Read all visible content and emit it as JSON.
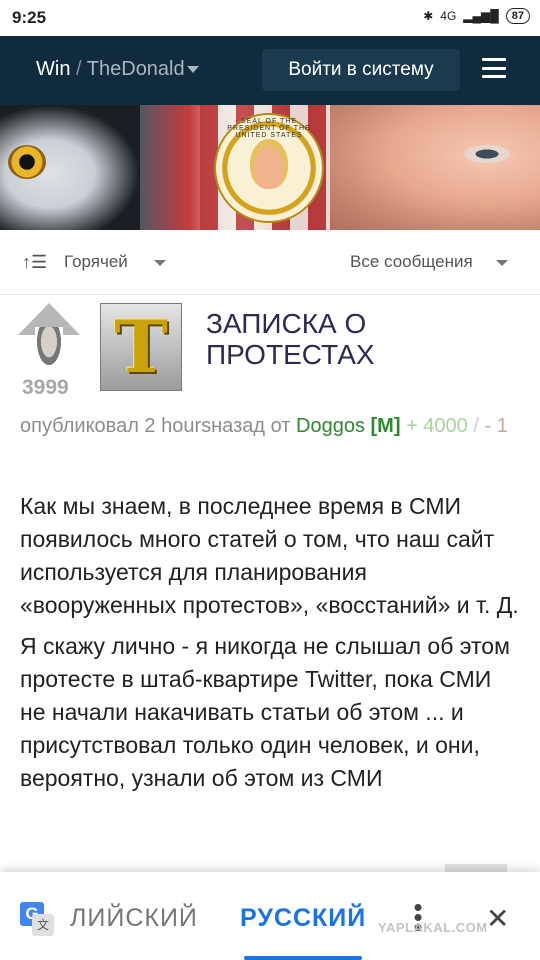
{
  "status_bar": {
    "time": "9:25",
    "network": "4G",
    "battery": "87"
  },
  "navbar": {
    "brand": "Win",
    "separator": "/",
    "community": "TheDonald",
    "login_label": "Войти в систему"
  },
  "banner": {
    "seal_text": "SEAL OF THE PRESIDENT OF THE UNITED STATES"
  },
  "sort": {
    "hot_label": "Горячей",
    "filter_label": "Все сообщения"
  },
  "post": {
    "score": "3999",
    "thumbnail_letter": "T",
    "title": "ЗАПИСКА О ПРОТЕСТАХ",
    "meta_prefix": "опубликовал 2 hoursназад от",
    "author": "Doggos",
    "mod_badge": "[M]",
    "upvotes": "+ 4000",
    "slash": "/",
    "downvotes": "- 1",
    "paragraphs": [
      "Как мы знаем, в последнее время в СМИ появилось много статей о том, что наш сайт используется для планирования «вооруженных протестов», «восстаний» и т. Д.",
      "Я скажу лично - я никогда не слышал об этом протесте в штаб-квартире Twitter, пока СМИ не начали накачивать статьи об этом ... и присутствовал только один человек, и они, вероятно, узнали об этом из СМИ"
    ]
  },
  "translate_bar": {
    "source_lang": "ЛИЙСКИЙ",
    "target_lang": "РУССКИЙ",
    "more_icon": "more-vert-icon",
    "close_icon": "close-icon"
  },
  "watermark": "YAPLAKAL.COM",
  "colors": {
    "navbar_bg": "#0f2b3d",
    "accent": "#1a73e8",
    "author": "#2e8a2e"
  }
}
